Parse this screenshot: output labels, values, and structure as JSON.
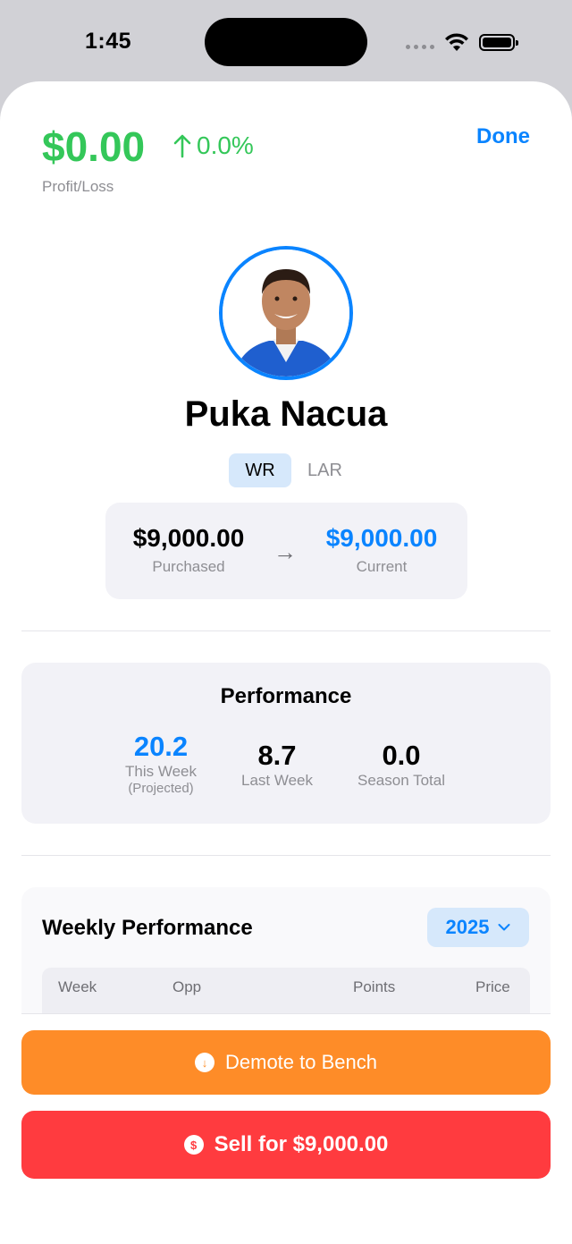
{
  "status": {
    "time": "1:45"
  },
  "header": {
    "profit_loss_value": "$0.00",
    "profit_loss_change": "0.0%",
    "profit_loss_label": "Profit/Loss",
    "done_label": "Done"
  },
  "player": {
    "name": "Puka Nacua",
    "position": "WR",
    "team": "LAR"
  },
  "prices": {
    "purchased_value": "$9,000.00",
    "purchased_label": "Purchased",
    "current_value": "$9,000.00",
    "current_label": "Current"
  },
  "performance": {
    "title": "Performance",
    "this_week_value": "20.2",
    "this_week_label": "This Week",
    "this_week_sub": "(Projected)",
    "last_week_value": "8.7",
    "last_week_label": "Last Week",
    "season_total_value": "0.0",
    "season_total_label": "Season Total"
  },
  "weekly": {
    "title": "Weekly Performance",
    "year": "2025",
    "columns": [
      "Week",
      "Opp",
      "Points",
      "Price"
    ]
  },
  "actions": {
    "demote_label": "Demote to Bench",
    "sell_label": "Sell for $9,000.00"
  },
  "colors": {
    "accent": "#0a84ff",
    "profit": "#34c759",
    "demote": "#fe8c28",
    "sell": "#ff3b3f"
  },
  "icons": [
    "wifi-icon",
    "battery-icon",
    "arrow-up-icon",
    "arrow-right-icon",
    "chevron-down-icon",
    "arrow-down-circle-icon",
    "dollar-circle-icon"
  ]
}
